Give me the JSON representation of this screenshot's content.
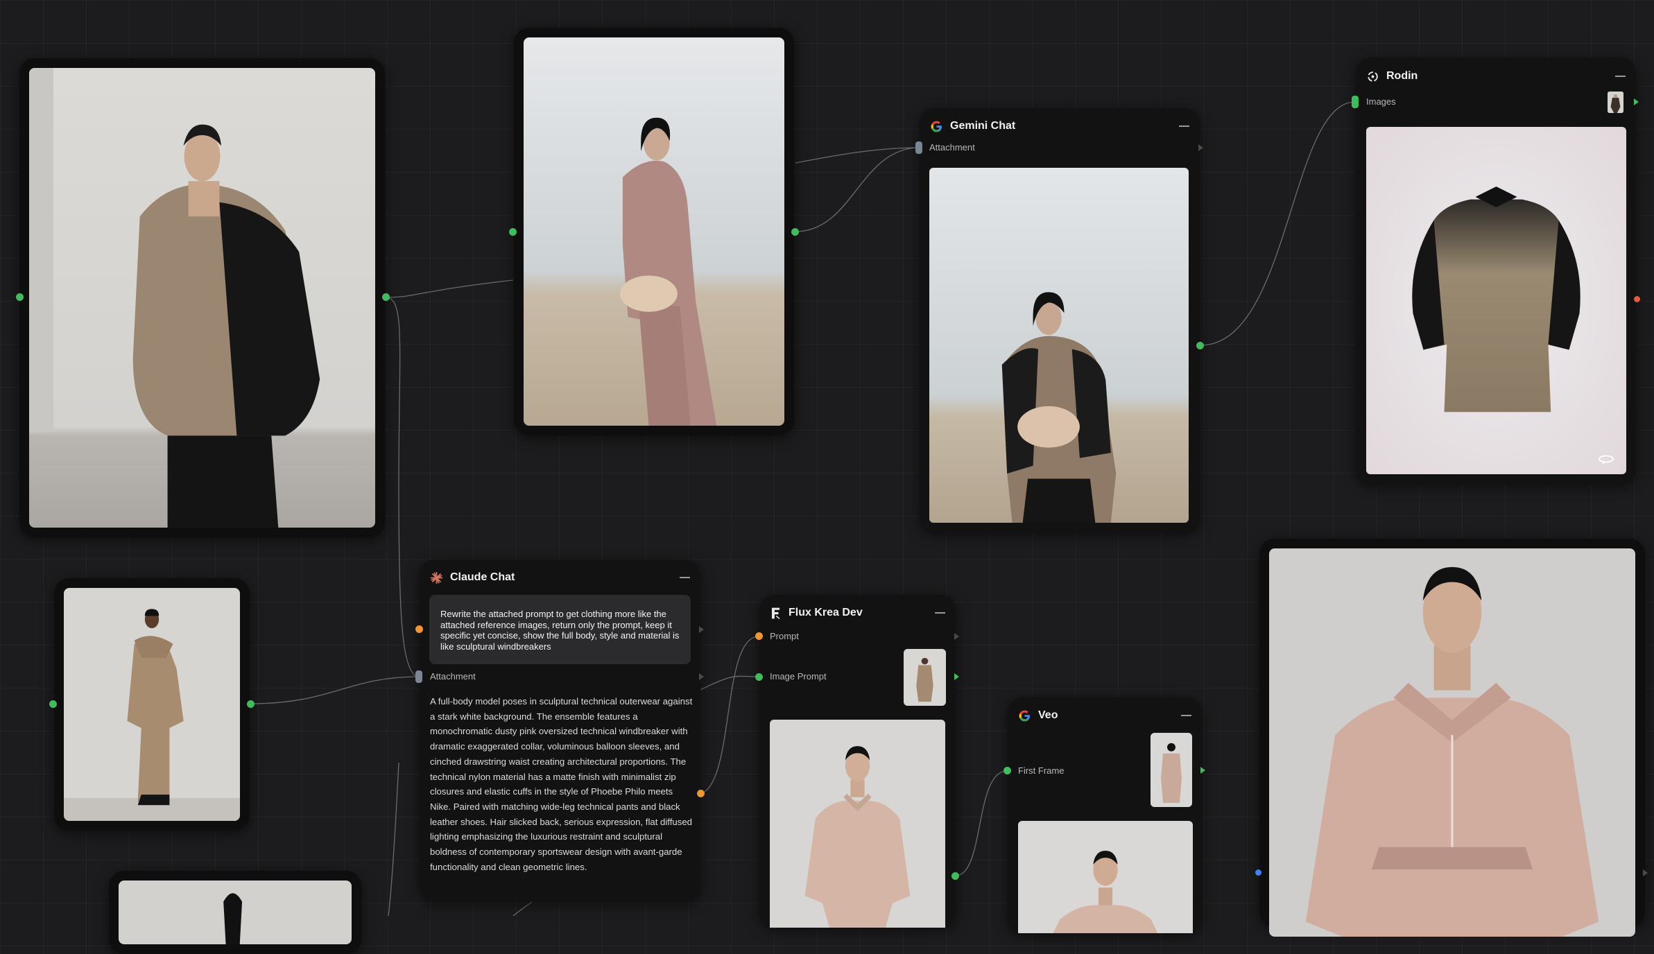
{
  "colors": {
    "canvas": "#1c1c1e",
    "card": "#0e0e0f",
    "port_green": "#3dbd5c",
    "port_orange": "#f0952f",
    "port_blue": "#3b82f6",
    "port_red": "#e85a3a",
    "wire": "#7a7a7a"
  },
  "nodes": {
    "gemini": {
      "icon": "google-g-icon",
      "title": "Gemini Chat",
      "input_label": "Attachment"
    },
    "rodin": {
      "icon": "rodin-logo-icon",
      "title": "Rodin",
      "input_label": "Images",
      "view_icon": "rotate-360-icon"
    },
    "claude": {
      "icon": "claude-sunburst-icon",
      "title": "Claude Chat",
      "prompt": "Rewrite the attached prompt to get clothing more like the attached reference images, return only the prompt, keep it specific yet concise, show the full body, style and material is like sculptural windbreakers",
      "input_label": "Attachment",
      "response": "A full-body model poses in sculptural technical outerwear against a stark white background. The ensemble features a monochromatic dusty pink oversized technical windbreaker with dramatic exaggerated collar, voluminous balloon sleeves, and cinched drawstring waist creating architectural proportions. The technical nylon material has a matte finish with minimalist zip closures and elastic cuffs in the style of Phoebe Philo meets Nike. Paired with matching wide-leg technical pants and black leather shoes. Hair slicked back, serious expression, flat diffused lighting emphasizing the luxurious restraint and sculptural boldness of contemporary sportswear design with avant-garde functionality and clean geometric lines."
    },
    "flux": {
      "icon": "flux-logo-icon",
      "title": "Flux Krea Dev",
      "prompt_label": "Prompt",
      "image_prompt_label": "Image Prompt"
    },
    "veo": {
      "icon": "google-g-icon",
      "title": "Veo",
      "first_frame_label": "First Frame"
    }
  },
  "images": [
    {
      "name": "image-node-leather-jacket",
      "subject": "model-photo"
    },
    {
      "name": "image-node-desert-pink-suit",
      "subject": "model-photo"
    },
    {
      "name": "image-node-beige-coat",
      "subject": "model-photo"
    },
    {
      "name": "image-node-bottom-partial",
      "subject": "model-photo"
    },
    {
      "name": "image-node-output-pink-windbreaker",
      "subject": "model-photo"
    }
  ]
}
